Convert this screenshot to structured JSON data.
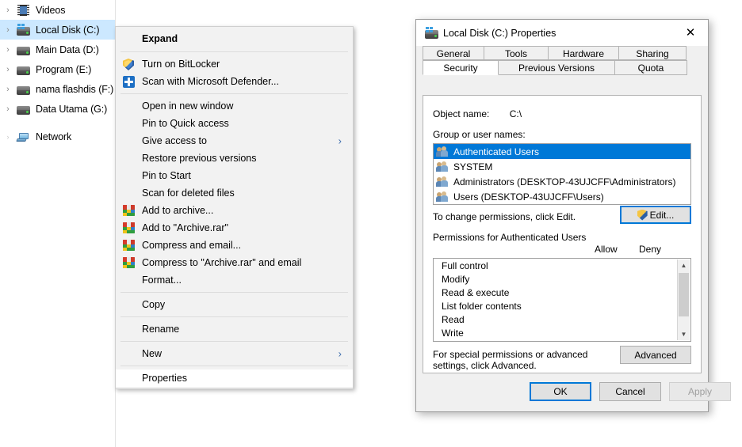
{
  "tree": {
    "items": [
      {
        "label": "Videos",
        "icon": "videos-folder-icon",
        "chevron": "›",
        "selected": false,
        "icon_type": "film"
      },
      {
        "label": "Local Disk (C:)",
        "icon": "windows-drive-icon",
        "chevron": "›",
        "selected": true,
        "icon_type": "windrive"
      },
      {
        "label": "Main Data (D:)",
        "icon": "drive-icon",
        "chevron": "›",
        "selected": false,
        "icon_type": "drive"
      },
      {
        "label": "Program (E:)",
        "icon": "drive-icon",
        "chevron": "›",
        "selected": false,
        "icon_type": "drive"
      },
      {
        "label": "nama flashdis (F:)",
        "icon": "drive-icon",
        "chevron": "›",
        "selected": false,
        "icon_type": "drive"
      },
      {
        "label": "Data Utama (G:)",
        "icon": "drive-icon",
        "chevron": "›",
        "selected": false,
        "icon_type": "drive"
      },
      {
        "label": "Network",
        "icon": "network-icon",
        "chevron": "›",
        "selected": false,
        "icon_type": "network"
      }
    ]
  },
  "context_menu": {
    "items": [
      {
        "label": "Expand",
        "type": "header",
        "icon": null
      },
      {
        "type": "separator"
      },
      {
        "label": "Turn on BitLocker",
        "type": "item",
        "icon": "shield-icon"
      },
      {
        "label": "Scan with Microsoft Defender...",
        "type": "item",
        "icon": "defender-icon"
      },
      {
        "type": "separator"
      },
      {
        "label": "Open in new window",
        "type": "item",
        "icon": null
      },
      {
        "label": "Pin to Quick access",
        "type": "item",
        "icon": null
      },
      {
        "label": "Give access to",
        "type": "item",
        "icon": null,
        "submenu": true
      },
      {
        "label": "Restore previous versions",
        "type": "item",
        "icon": null
      },
      {
        "label": "Pin to Start",
        "type": "item",
        "icon": null
      },
      {
        "label": "Scan for deleted files",
        "type": "item",
        "icon": null
      },
      {
        "label": "Add to archive...",
        "type": "item",
        "icon": "winrar-icon"
      },
      {
        "label": "Add to \"Archive.rar\"",
        "type": "item",
        "icon": "winrar-icon"
      },
      {
        "label": "Compress and email...",
        "type": "item",
        "icon": "winrar-icon"
      },
      {
        "label": "Compress to \"Archive.rar\" and email",
        "type": "item",
        "icon": "winrar-icon"
      },
      {
        "label": "Format...",
        "type": "item",
        "icon": null
      },
      {
        "type": "separator"
      },
      {
        "label": "Copy",
        "type": "item",
        "icon": null
      },
      {
        "type": "separator"
      },
      {
        "label": "Rename",
        "type": "item",
        "icon": null
      },
      {
        "type": "separator"
      },
      {
        "label": "New",
        "type": "item",
        "icon": null,
        "submenu": true
      },
      {
        "type": "separator"
      },
      {
        "label": "Properties",
        "type": "item",
        "icon": null,
        "hovered": true
      }
    ]
  },
  "dialog": {
    "title": "Local Disk (C:) Properties",
    "title_icon": "drive-icon",
    "close_label": "✕",
    "tabs_row1": [
      "General",
      "Tools",
      "Hardware",
      "Sharing"
    ],
    "tabs_row2": [
      "Security",
      "Previous Versions",
      "Quota"
    ],
    "active_tab": "Security",
    "object_name_label": "Object name:",
    "object_name_value": "C:\\",
    "group_users_label": "Group or user names:",
    "group_users": [
      {
        "name": "Authenticated Users",
        "selected": true
      },
      {
        "name": "SYSTEM",
        "selected": false
      },
      {
        "name": "Administrators (DESKTOP-43UJCFF\\Administrators)",
        "selected": false
      },
      {
        "name": "Users (DESKTOP-43UJCFF\\Users)",
        "selected": false
      }
    ],
    "change_permissions_text": "To change permissions, click Edit.",
    "edit_button": "Edit...",
    "permissions_label": "Permissions for Authenticated Users",
    "allow_header": "Allow",
    "deny_header": "Deny",
    "permissions": [
      "Full control",
      "Modify",
      "Read & execute",
      "List folder contents",
      "Read",
      "Write"
    ],
    "special_text": "For special permissions or advanced settings, click Advanced.",
    "advanced_button": "Advanced",
    "ok_button": "OK",
    "cancel_button": "Cancel",
    "apply_button": "Apply",
    "apply_disabled": true
  },
  "colors": {
    "selection_blue": "#0078d7",
    "tree_selection": "#cce8ff",
    "menu_bg": "#f2f2f2",
    "dialog_bg": "#f0f0f0"
  }
}
